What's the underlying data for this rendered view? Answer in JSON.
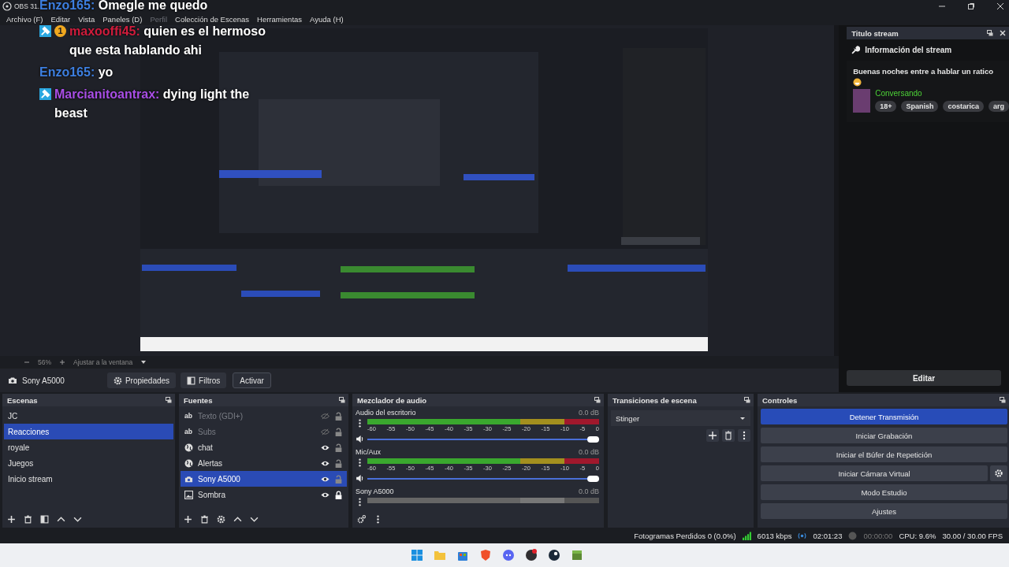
{
  "window": {
    "title": "OBS 31."
  },
  "menu": [
    {
      "label": "Archivo (F)",
      "disabled": false
    },
    {
      "label": "Editar",
      "disabled": false
    },
    {
      "label": "Vista",
      "disabled": false
    },
    {
      "label": "Paneles (D)",
      "disabled": false
    },
    {
      "label": "Perfil",
      "disabled": true
    },
    {
      "label": "Colección de Escenas",
      "disabled": false
    },
    {
      "label": "Herramientas",
      "disabled": false
    },
    {
      "label": "Ayuda (H)",
      "disabled": false
    }
  ],
  "chat_overlay": [
    {
      "user": "Enzo165:",
      "color": "#3d7fe0",
      "text": "Omegle me quedo"
    },
    {
      "user": "maxooffi45:",
      "color": "#d01c3c",
      "badges": [
        {
          "kind": "moderator"
        },
        {
          "kind": "tier",
          "label": "1"
        }
      ],
      "text": "quien es el hermoso que esta hablando ahi"
    },
    {
      "user": "Enzo165:",
      "color": "#3d7fe0",
      "text": "yo"
    },
    {
      "user": "Marcianitoantrax:",
      "color": "#a94ee6",
      "badges": [
        {
          "kind": "moderator"
        }
      ],
      "text": "dying light the beast"
    }
  ],
  "zoom_bar": {
    "value": "56%",
    "fit": "Ajustar a la ventana"
  },
  "source_toolbar": {
    "source": "Sony A5000",
    "buttons": [
      "Propiedades",
      "Filtros",
      "Activar"
    ]
  },
  "stream_dock": {
    "title": "Titulo stream",
    "heading": "Información del stream",
    "description": "Buenas noches entre a hablar un ratico",
    "category": "Conversando",
    "tags": [
      "18+",
      "Spanish",
      "costarica",
      "arg"
    ],
    "button": "Editar"
  },
  "scenes": {
    "title": "Escenas",
    "items": [
      {
        "name": "JC",
        "selected": false
      },
      {
        "name": "Reacciones",
        "selected": true
      },
      {
        "name": "royale",
        "selected": false
      },
      {
        "name": "Juegos",
        "selected": false
      },
      {
        "name": "Inicio stream",
        "selected": false
      }
    ]
  },
  "sources": {
    "title": "Fuentes",
    "items": [
      {
        "name": "Texto (GDI+)",
        "kind": "text",
        "glyph": "ab",
        "visible": false,
        "locked": false,
        "selected": false
      },
      {
        "name": "Subs",
        "kind": "text",
        "glyph": "ab",
        "visible": false,
        "locked": false,
        "selected": false
      },
      {
        "name": "chat",
        "kind": "browser",
        "visible": true,
        "locked": false,
        "selected": false
      },
      {
        "name": "Alertas",
        "kind": "browser",
        "visible": true,
        "locked": false,
        "selected": false
      },
      {
        "name": "Sony A5000",
        "kind": "camera",
        "visible": true,
        "locked": false,
        "selected": true
      },
      {
        "name": "Sombra",
        "kind": "image",
        "visible": true,
        "locked": true,
        "selected": false
      }
    ]
  },
  "mixer": {
    "title": "Mezclador de audio",
    "channels": [
      {
        "name": "Audio del escritorio",
        "reading": "0.0 dB",
        "level": 1,
        "ticks": [
          "-60",
          "-55",
          "-50",
          "-45",
          "-40",
          "-35",
          "-30",
          "-25",
          "-20",
          "-15",
          "-10",
          "-5",
          "0"
        ]
      },
      {
        "name": "Mic/Aux",
        "reading": "0.0 dB",
        "level": 1,
        "ticks": [
          "-60",
          "-55",
          "-50",
          "-45",
          "-40",
          "-35",
          "-30",
          "-25",
          "-20",
          "-15",
          "-10",
          "-5",
          "0"
        ]
      },
      {
        "name": "Sony A5000",
        "reading": "0.0 dB"
      }
    ]
  },
  "transitions": {
    "title": "Transiciones de escena",
    "value": "Stinger"
  },
  "controls": {
    "title": "Controles",
    "buttons": [
      {
        "label": "Detener Transmisión",
        "active": true,
        "settings": false
      },
      {
        "label": "Iniciar Grabación",
        "active": false,
        "settings": false
      },
      {
        "label": "Iniciar el Búfer de Repetición",
        "active": false,
        "settings": false
      },
      {
        "label": "Iniciar Cámara Virtual",
        "active": false,
        "settings": true
      },
      {
        "label": "Modo Estudio",
        "active": false,
        "settings": false
      },
      {
        "label": "Ajustes",
        "active": false,
        "settings": false
      }
    ]
  },
  "status_bar": {
    "dropped": "Fotogramas Perdidos 0 (0.0%)",
    "bitrate": "6013 kbps",
    "stream_time": "02:01:23",
    "record_time": "00:00:00",
    "cpu": "CPU: 9.6%",
    "fps": "30.00 / 30.00 FPS"
  }
}
